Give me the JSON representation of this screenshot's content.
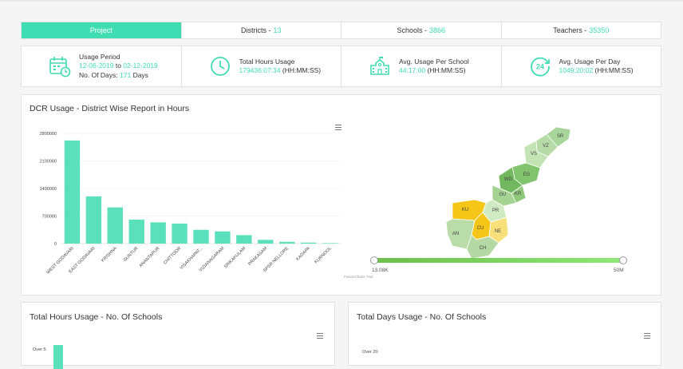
{
  "tabs": [
    {
      "label": "Project",
      "count": ""
    },
    {
      "label": "Districts - ",
      "count": "13"
    },
    {
      "label": "Schools - ",
      "count": "3866"
    },
    {
      "label": "Teachers - ",
      "count": "35350"
    }
  ],
  "stats": {
    "usage_period": {
      "label": "Usage Period",
      "from": "12-06-2019",
      "to_word": " to ",
      "to": "02-12-2019",
      "days_label": "No. Of Days: ",
      "days": "171",
      "days_unit": " Days"
    },
    "total_hours": {
      "label": "Total Hours Usage",
      "value": "179436:07:34",
      "unit": " (HH:MM:SS)"
    },
    "avg_school": {
      "label": "Avg. Usage Per School",
      "value": "44:17:00",
      "unit": " (HH:MM:SS)"
    },
    "avg_day": {
      "label": "Avg. Usage Per Day",
      "value": "1049:20:02",
      "unit": " (HH:MM:SS)",
      "icon_text": "24"
    }
  },
  "dcr_panel": {
    "title": "DCR Usage - District Wise Report in Hours",
    "trial": "FusionCharts Trial",
    "map_min": "13.08K",
    "map_max": "50M",
    "map_labels": [
      "SR",
      "VZ",
      "VS",
      "EG",
      "WG",
      "KR",
      "GU",
      "PR",
      "KU",
      "AN",
      "CU",
      "NE",
      "CH"
    ]
  },
  "hours_panel": {
    "title": "Total Hours Usage - No. Of Schools",
    "first_tick": "Over 5"
  },
  "days_panel": {
    "title": "Total Days Usage - No. Of Schools",
    "first_tick": "Over 20"
  },
  "chart_data": {
    "type": "bar",
    "title": "DCR Usage - District Wise Report in Hours",
    "categories": [
      "WEST GODAVARI",
      "EAST GODAVARI",
      "KRISHNA",
      "GUNTUR",
      "ANANTAPUR",
      "CHITTOOR",
      "VISAKHAPAT...",
      "VIZIANAGARAM",
      "SRIKAKULAM",
      "PRAKASAM",
      "SPSR NELLORE",
      "KADAPA",
      "KURNOOL"
    ],
    "values": [
      2620000,
      1200000,
      920000,
      610000,
      540000,
      510000,
      350000,
      310000,
      215000,
      95000,
      45000,
      25000,
      12000
    ],
    "yticks": [
      "2800000",
      "2100000",
      "1400000",
      "700000",
      "0"
    ],
    "ylim": [
      0,
      2800000
    ],
    "color": "#5ae0bb"
  }
}
